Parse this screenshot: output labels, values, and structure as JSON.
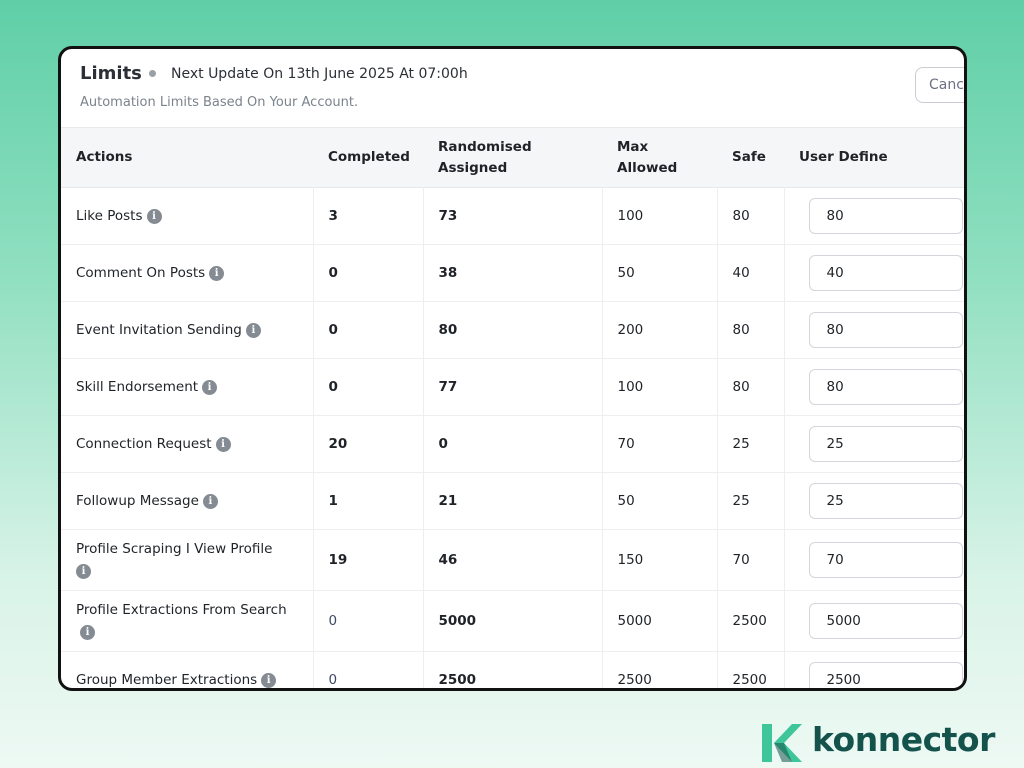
{
  "header": {
    "title": "Limits",
    "next_update": "Next Update On 13th June 2025 At 07:00h",
    "subtitle": "Automation Limits Based On Your Account.",
    "cancel_label": "Canc"
  },
  "table": {
    "columns": {
      "actions": "Actions",
      "completed": "Completed",
      "randomised_line1": "Randomised",
      "randomised_line2": "Assigned",
      "max_line1": "Max",
      "max_line2": "Allowed",
      "safe": "Safe",
      "user_define": "User Define"
    },
    "rows": [
      {
        "action": "Like Posts",
        "completed": "3",
        "randomised": "73",
        "max": "100",
        "safe": "80",
        "user_define": "80"
      },
      {
        "action": "Comment On Posts",
        "completed": "0",
        "randomised": "38",
        "max": "50",
        "safe": "40",
        "user_define": "40"
      },
      {
        "action": "Event Invitation Sending",
        "completed": "0",
        "randomised": "80",
        "max": "200",
        "safe": "80",
        "user_define": "80"
      },
      {
        "action": "Skill Endorsement",
        "completed": "0",
        "randomised": "77",
        "max": "100",
        "safe": "80",
        "user_define": "80"
      },
      {
        "action": "Connection Request",
        "completed": "20",
        "randomised": "0",
        "max": "70",
        "safe": "25",
        "user_define": "25"
      },
      {
        "action": "Followup Message",
        "completed": "1",
        "randomised": "21",
        "max": "50",
        "safe": "25",
        "user_define": "25"
      },
      {
        "action": "Profile Scraping I View Profile",
        "completed": "19",
        "randomised": "46",
        "max": "150",
        "safe": "70",
        "user_define": "70"
      },
      {
        "action": "Profile Extractions From Search",
        "completed": "0",
        "randomised": "5000",
        "max": "5000",
        "safe": "2500",
        "user_define": "5000"
      },
      {
        "action": "Group Member Extractions",
        "completed": "0",
        "randomised": "2500",
        "max": "2500",
        "safe": "2500",
        "user_define": "2500"
      }
    ]
  },
  "info_icon_glyph": "i",
  "icons": {
    "info": "info-icon"
  },
  "brand": {
    "name": "konnector",
    "color_text": "#14524c",
    "color_mark": "#3ec69a"
  }
}
